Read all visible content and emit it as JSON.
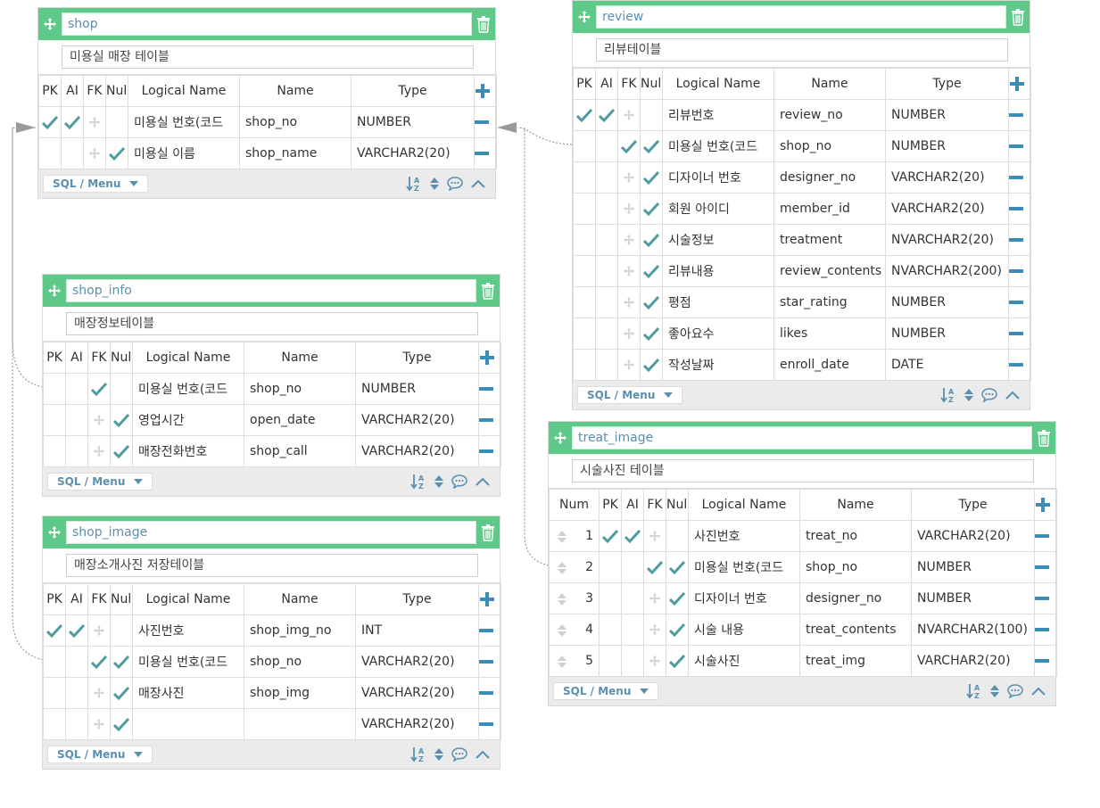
{
  "headers": {
    "num": "Num",
    "pk": "PK",
    "ai": "AI",
    "fk": "FK",
    "null": "Null",
    "logical": "Logical Name",
    "name": "Name",
    "type": "Type"
  },
  "footer": {
    "sql_menu": "SQL / Menu"
  },
  "colors": {
    "header": "#5fc98a",
    "check": "#4f9c9f",
    "accent": "#3a8db9",
    "footer": "#ebebeb"
  },
  "tables": {
    "shop": {
      "name": "shop",
      "comment": "미용실 매장 테이블",
      "rows": [
        {
          "pk": true,
          "ai": true,
          "fk": false,
          "null": false,
          "logical": "미용실 번호(코드",
          "name": "shop_no",
          "type": "NUMBER"
        },
        {
          "pk": false,
          "ai": false,
          "fk": false,
          "null": true,
          "logical": "미용실 이름",
          "name": "shop_name",
          "type": "VARCHAR2(20)"
        }
      ]
    },
    "shop_info": {
      "name": "shop_info",
      "comment": "매장정보테이블",
      "rows": [
        {
          "pk": false,
          "ai": false,
          "fk": true,
          "null": false,
          "logical": "미용실 번호(코드",
          "name": "shop_no",
          "type": "NUMBER"
        },
        {
          "pk": false,
          "ai": false,
          "fk": false,
          "null": true,
          "logical": "영업시간",
          "name": "open_date",
          "type": "VARCHAR2(20)"
        },
        {
          "pk": false,
          "ai": false,
          "fk": false,
          "null": true,
          "logical": "매장전화번호",
          "name": "shop_call",
          "type": "VARCHAR2(20)"
        }
      ]
    },
    "shop_image": {
      "name": "shop_image",
      "comment": "매장소개사진 저장테이블",
      "rows": [
        {
          "pk": true,
          "ai": true,
          "fk": false,
          "null": false,
          "logical": "사진번호",
          "name": "shop_img_no",
          "type": "INT"
        },
        {
          "pk": false,
          "ai": false,
          "fk": true,
          "null": true,
          "logical": "미용실 번호(코드",
          "name": "shop_no",
          "type": "VARCHAR2(20)"
        },
        {
          "pk": false,
          "ai": false,
          "fk": false,
          "null": true,
          "logical": "매장사진",
          "name": "shop_img",
          "type": "VARCHAR2(20)"
        },
        {
          "pk": false,
          "ai": false,
          "fk": false,
          "null": true,
          "logical": "",
          "name": "",
          "type": "VARCHAR2(20)"
        }
      ]
    },
    "review": {
      "name": "review",
      "comment": "리뷰테이블",
      "rows": [
        {
          "pk": true,
          "ai": true,
          "fk": false,
          "null": false,
          "logical": "리뷰번호",
          "name": "review_no",
          "type": "NUMBER"
        },
        {
          "pk": false,
          "ai": false,
          "fk": true,
          "null": true,
          "logical": "미용실 번호(코드",
          "name": "shop_no",
          "type": "NUMBER"
        },
        {
          "pk": false,
          "ai": false,
          "fk": false,
          "null": true,
          "logical": "디자이너 번호",
          "name": "designer_no",
          "type": "VARCHAR2(20)"
        },
        {
          "pk": false,
          "ai": false,
          "fk": false,
          "null": true,
          "logical": "회원 아이디",
          "name": "member_id",
          "type": "VARCHAR2(20)"
        },
        {
          "pk": false,
          "ai": false,
          "fk": false,
          "null": true,
          "logical": "시술정보",
          "name": "treatment",
          "type": "NVARCHAR2(20)"
        },
        {
          "pk": false,
          "ai": false,
          "fk": false,
          "null": true,
          "logical": "리뷰내용",
          "name": "review_contents",
          "type": "NVARCHAR2(200)"
        },
        {
          "pk": false,
          "ai": false,
          "fk": false,
          "null": true,
          "logical": "평점",
          "name": "star_rating",
          "type": "NUMBER"
        },
        {
          "pk": false,
          "ai": false,
          "fk": false,
          "null": true,
          "logical": "좋아요수",
          "name": "likes",
          "type": "NUMBER"
        },
        {
          "pk": false,
          "ai": false,
          "fk": false,
          "null": true,
          "logical": "작성날짜",
          "name": "enroll_date",
          "type": "DATE"
        }
      ]
    },
    "treat_image": {
      "name": "treat_image",
      "comment": "시술사진 테이블",
      "rows": [
        {
          "num": "1",
          "pk": true,
          "ai": true,
          "fk": false,
          "null": false,
          "logical": "사진번호",
          "name": "treat_no",
          "type": "VARCHAR2(20)"
        },
        {
          "num": "2",
          "pk": false,
          "ai": false,
          "fk": true,
          "null": true,
          "logical": "미용실 번호(코드",
          "name": "shop_no",
          "type": "NUMBER"
        },
        {
          "num": "3",
          "pk": false,
          "ai": false,
          "fk": false,
          "null": true,
          "logical": "디자이너 번호",
          "name": "designer_no",
          "type": "NUMBER"
        },
        {
          "num": "4",
          "pk": false,
          "ai": false,
          "fk": false,
          "null": true,
          "logical": "시술 내용",
          "name": "treat_contents",
          "type": "NVARCHAR2(100)"
        },
        {
          "num": "5",
          "pk": false,
          "ai": false,
          "fk": false,
          "null": true,
          "logical": "시술사진",
          "name": "treat_img",
          "type": "VARCHAR2(20)"
        }
      ]
    }
  }
}
